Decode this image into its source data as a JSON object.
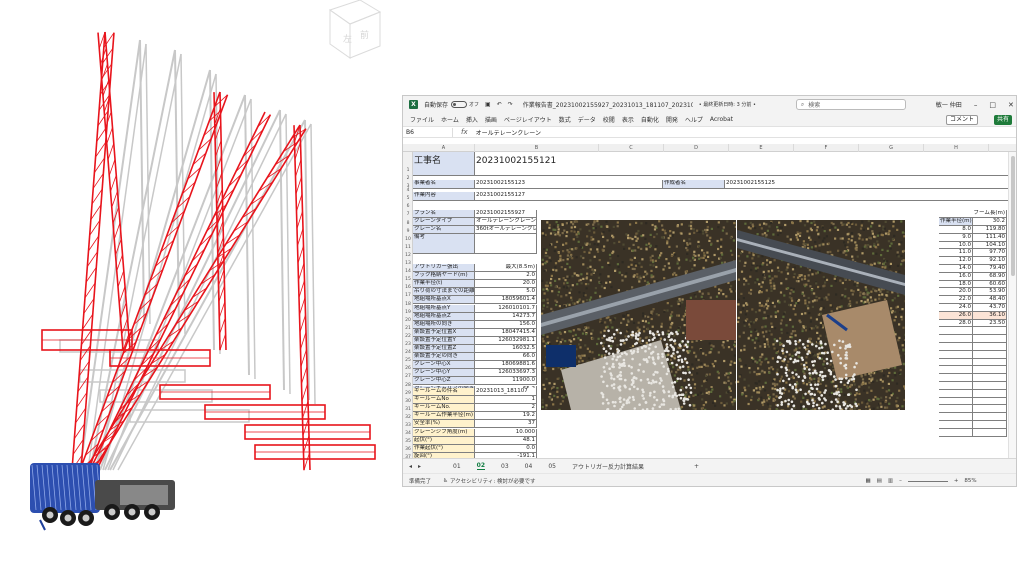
{
  "titlebar": {
    "autosave_label": "自動保存",
    "autosave_state": "オフ",
    "filename": "作業報告書_20231002155927_20231013_181107_20231013181024...",
    "saved_state": "• 最終更新日時: 3 分前 •",
    "search_placeholder": "検索",
    "user": "敏一 仲田"
  },
  "ribbon": {
    "items": [
      "ファイル",
      "ホーム",
      "挿入",
      "描画",
      "ページレイアウト",
      "数式",
      "データ",
      "校閲",
      "表示",
      "自動化",
      "開発",
      "ヘルプ",
      "Acrobat"
    ],
    "comment_label": "コメント",
    "share_label": "共有"
  },
  "formula_bar": {
    "name_box": "B6",
    "fx": "fx",
    "value": "オールテレーンクレーン"
  },
  "columns": [
    "A",
    "B",
    "C",
    "D",
    "E",
    "F",
    "G",
    "H",
    "I",
    "J",
    "K",
    "L"
  ],
  "rows": [
    "1",
    "2",
    "3",
    "4",
    "5",
    "6",
    "7",
    "8",
    "9",
    "10",
    "11",
    "12",
    "13",
    "14",
    "15",
    "16",
    "17",
    "18",
    "19",
    "20",
    "21",
    "22",
    "23",
    "24",
    "25",
    "26",
    "27",
    "28",
    "29",
    "30",
    "31",
    "32",
    "33",
    "34",
    "35",
    "36",
    "37"
  ],
  "header_block": {
    "koujimei_label": "工事名",
    "koujimei_value": "20231002155121",
    "jigyousha_label": "事業者名",
    "jigyousha_value": "20231002155123",
    "sakusei_label": "作成者名",
    "sakusei_value": "20231002155125",
    "sagyou_label": "作業内容",
    "sagyou_value": "20231002155127"
  },
  "plan_block": [
    {
      "label": "プラン名",
      "value": "20231002155927"
    },
    {
      "label": "クレーンタイプ",
      "value": "オールテレーンクレーン"
    },
    {
      "label": "クレーン名",
      "value": "360tオールテレーンクレ..."
    },
    {
      "label": "備考",
      "value": ""
    }
  ],
  "outrigger_block": [
    {
      "label": "アウトリガー張出",
      "value": "最大(8.5m)"
    },
    {
      "label": "フック格納ヤード(m)",
      "value": "2.0"
    },
    {
      "label": "作業半径(t)",
      "value": "20.0"
    },
    {
      "label": "吊り荷の寸法までの距離(m)",
      "value": "5.0"
    },
    {
      "label": "地組場所基点X",
      "value": "18059601.4"
    },
    {
      "label": "地組場所基点Y",
      "value": "126010101.7"
    },
    {
      "label": "地組場所基点Z",
      "value": "14273.7"
    },
    {
      "label": "地組場所の向き",
      "value": "156.0"
    },
    {
      "label": "楽設置予定位置X",
      "value": "18047415.4"
    },
    {
      "label": "楽設置予定位置Y",
      "value": "126032981.1"
    },
    {
      "label": "楽設置予定位置Z",
      "value": "16032.5"
    },
    {
      "label": "楽設置予定の向き",
      "value": "66.0"
    },
    {
      "label": "クレーン中心X",
      "value": "18069881.6"
    },
    {
      "label": "クレーン中心Y",
      "value": "126033697.3"
    },
    {
      "label": "クレーン中心Z",
      "value": "11900.0"
    },
    {
      "label": "クレーンキャリアの向き",
      "value": "65.2"
    }
  ],
  "yellow_block": [
    {
      "label": "キールームの件名",
      "value": "20231013_181107"
    },
    {
      "label": "キールームNo",
      "value": "1"
    },
    {
      "label": "キールームNo.",
      "value": "2"
    },
    {
      "label": "キールーム作業半径(m)",
      "value": "19.2"
    },
    {
      "label": "安全率(%)",
      "value": "37"
    },
    {
      "label": "クレーンジブ角度(m)",
      "value": "10.000"
    },
    {
      "label": "起伏(°)",
      "value": "48.1"
    },
    {
      "label": "作業起伏(°)",
      "value": "0.0"
    },
    {
      "label": "旋回(°)",
      "value": "-191.1"
    }
  ],
  "right_table": {
    "header_left": "作業半径(m)",
    "header_right": "ブーム長(m)",
    "top_value": "30.2",
    "rows": [
      {
        "r": "8.0",
        "v": "119.80"
      },
      {
        "r": "9.0",
        "v": "111.40"
      },
      {
        "r": "10.0",
        "v": "104.10"
      },
      {
        "r": "11.0",
        "v": "97.70"
      },
      {
        "r": "12.0",
        "v": "92.10"
      },
      {
        "r": "14.0",
        "v": "79.40"
      },
      {
        "r": "16.0",
        "v": "68.90"
      },
      {
        "r": "18.0",
        "v": "60.60"
      },
      {
        "r": "20.0",
        "v": "53.90"
      },
      {
        "r": "22.0",
        "v": "48.40"
      },
      {
        "r": "24.0",
        "v": "43.70"
      },
      {
        "r": "26.0",
        "v": "36.10"
      },
      {
        "r": "28.0",
        "v": "23.50"
      }
    ]
  },
  "sheet_tabs": [
    "01",
    "02",
    "03",
    "04",
    "05",
    "アウトリガー反力計算結果"
  ],
  "active_tab": "02",
  "statusbar": {
    "ready": "準備完了",
    "accessibility": "アクセシビリティ: 検討が必要です",
    "zoom": "85%"
  },
  "colors": {
    "crane_red": "#e8141c",
    "crane_gray": "#c8c8c8",
    "crane_blue": "#1e3f9a",
    "label_blue": "#d9e1f2",
    "label_yellow": "#fff2cc",
    "excel_green": "#107c41"
  }
}
